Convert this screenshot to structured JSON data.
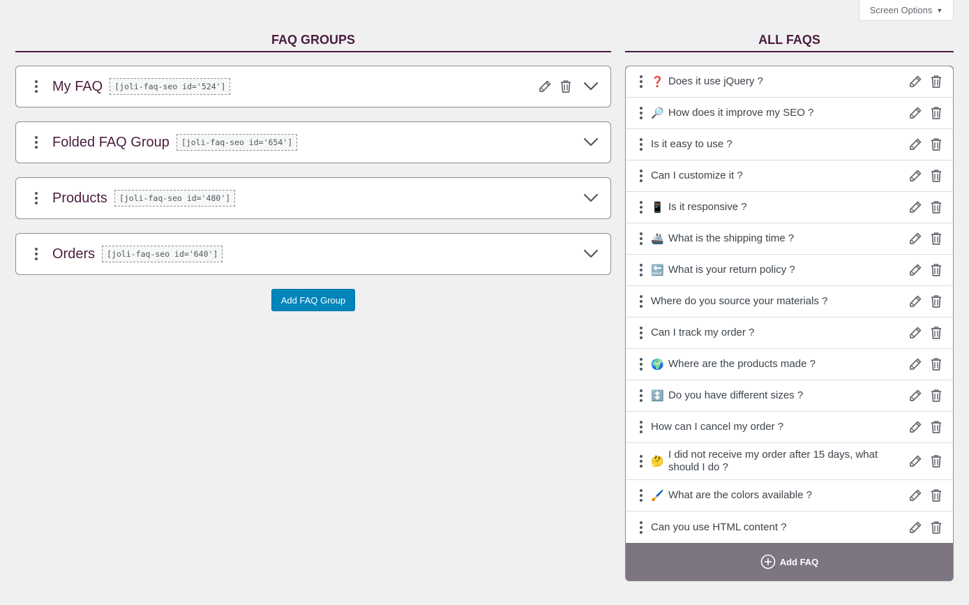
{
  "screen_options": {
    "label": "Screen Options",
    "caret": "▼"
  },
  "groups_section": {
    "title": "FAQ GROUPS",
    "groups": [
      {
        "name": "My FAQ",
        "shortcode": "[joli-faq-seo id='524']",
        "show_actions": true
      },
      {
        "name": "Folded FAQ Group",
        "shortcode": "[joli-faq-seo id='654']",
        "show_actions": false
      },
      {
        "name": "Products",
        "shortcode": "[joli-faq-seo id='480']",
        "show_actions": false
      },
      {
        "name": "Orders",
        "shortcode": "[joli-faq-seo id='640']",
        "show_actions": false
      }
    ],
    "add_button": "Add FAQ Group"
  },
  "faqs_section": {
    "title": "ALL FAQS",
    "faqs": [
      {
        "emoji": "❓",
        "text": "Does it use jQuery ?"
      },
      {
        "emoji": "🔎",
        "text": "How does it improve my SEO ?"
      },
      {
        "emoji": "",
        "text": "Is it easy to use ?"
      },
      {
        "emoji": "",
        "text": "Can I customize it ?"
      },
      {
        "emoji": "📱",
        "text": "Is it responsive ?"
      },
      {
        "emoji": "🚢",
        "text": "What is the shipping time ?"
      },
      {
        "emoji": "🔙",
        "text": "What is your return policy ?"
      },
      {
        "emoji": "",
        "text": "Where do you source your materials ?"
      },
      {
        "emoji": "",
        "text": "Can I track my order ?"
      },
      {
        "emoji": "🌍",
        "text": "Where are the products made ?"
      },
      {
        "emoji": "↕️",
        "text": "Do you have different sizes ?"
      },
      {
        "emoji": "",
        "text": "How can I cancel my order ?"
      },
      {
        "emoji": "🤔",
        "text": "I did not receive my order after 15 days, what should I do ?"
      },
      {
        "emoji": "🖌️",
        "text": "What are the colors available ?"
      },
      {
        "emoji": "",
        "text": "Can you use HTML content ?"
      }
    ],
    "add_button": "Add FAQ"
  },
  "icons": {
    "drag": "drag-handle-icon",
    "edit": "pencil-icon",
    "delete": "trash-icon",
    "expand": "chevron-down-icon",
    "add": "plus-circle-icon"
  },
  "colors": {
    "brand": "#4b1d3f",
    "button": "#0085ba",
    "panel_footer": "#7d7582"
  }
}
